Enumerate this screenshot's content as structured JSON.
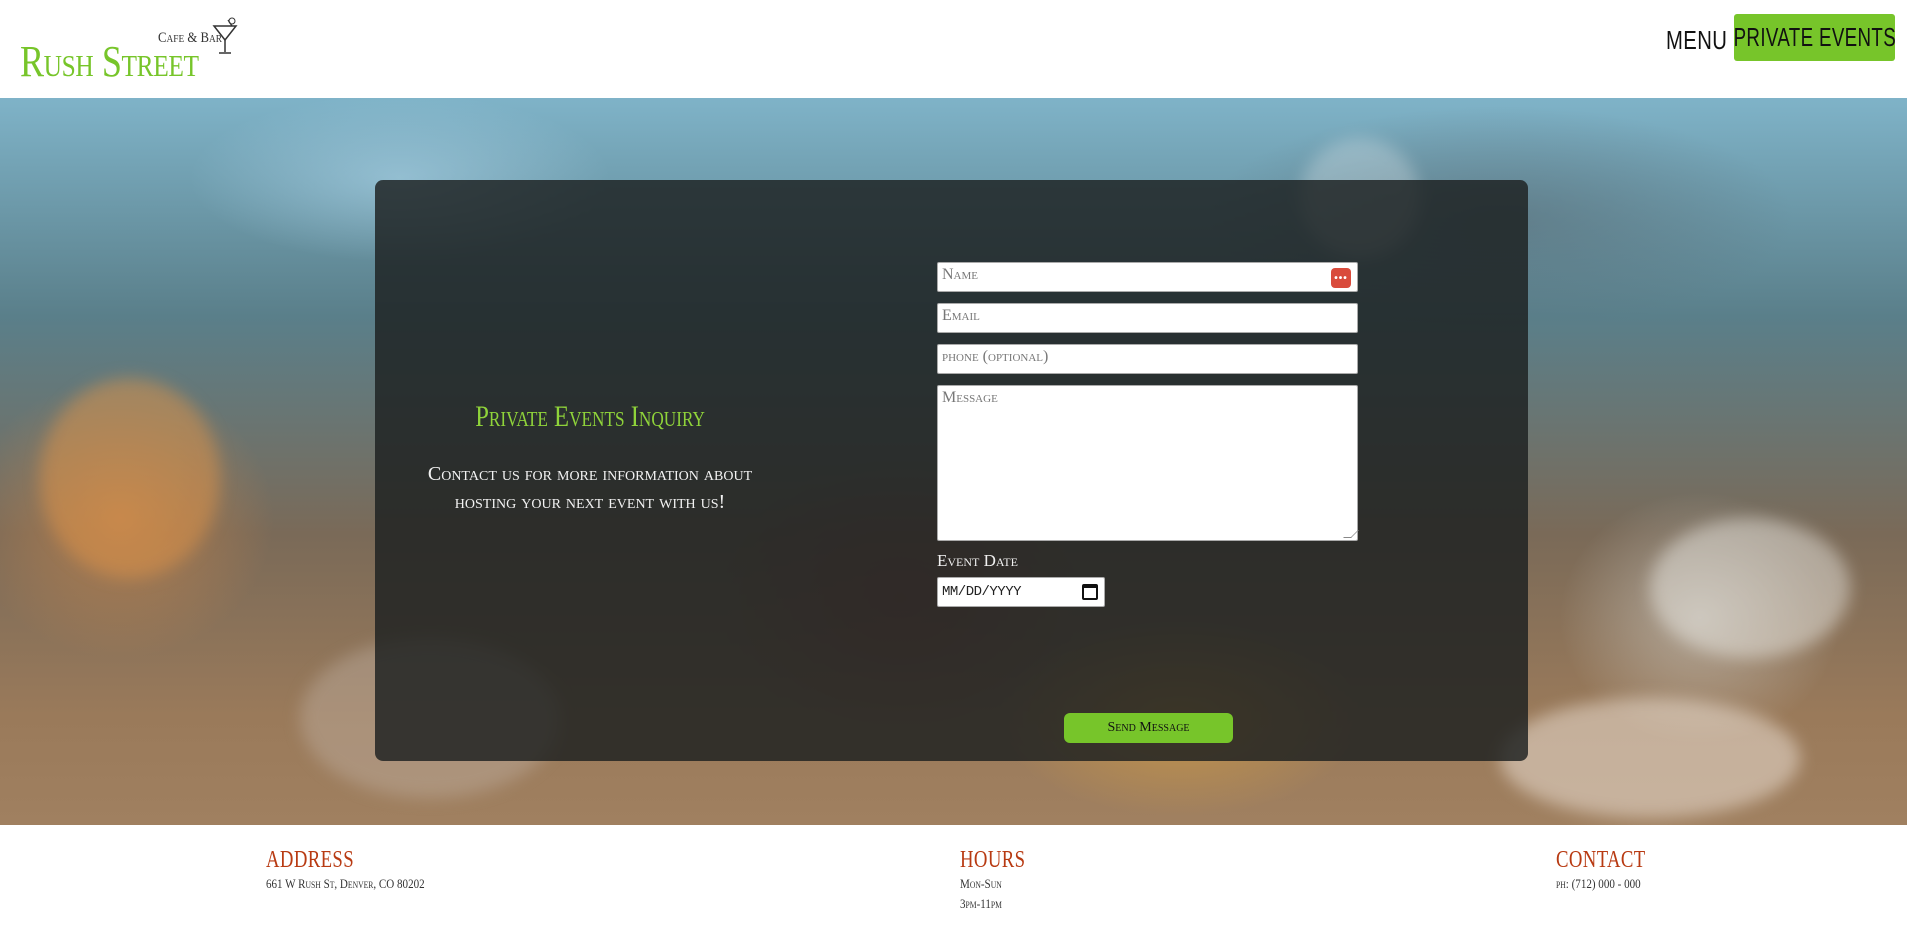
{
  "header": {
    "logo_name": "Rush Street",
    "logo_sub": "Cafe & Bar",
    "nav": {
      "menu_label": "MENU",
      "private_events_label": "PRIVATE EVENTS"
    }
  },
  "inquiry": {
    "title": "Private Events Inquiry",
    "description": "Contact us for more information about hosting your next event with us!",
    "form": {
      "name_placeholder": "Name",
      "email_placeholder": "Email",
      "phone_placeholder": "phone (optional)",
      "message_placeholder": "Message",
      "event_date_label": "Event Date",
      "event_date_value": "MM/DD/YYYY",
      "send_label": "Send Message"
    }
  },
  "footer": {
    "address": {
      "heading": "ADDRESS",
      "line1": "661 W Rush St, Denver, CO 80202"
    },
    "hours": {
      "heading": "HOURS",
      "line1": "Mon-Sun",
      "line2": "3pm-11pm"
    },
    "contact": {
      "heading": "CONTACT",
      "line1": "ph: (712) 000 - 000"
    }
  },
  "colors": {
    "accent_green": "#77c52a",
    "title_green": "#8fd33a",
    "footer_heading": "#b83a12",
    "panel_bg": "rgba(28,32,32,0.82)"
  },
  "icons": [
    "martini-glass-icon",
    "password-manager-icon",
    "calendar-icon"
  ]
}
